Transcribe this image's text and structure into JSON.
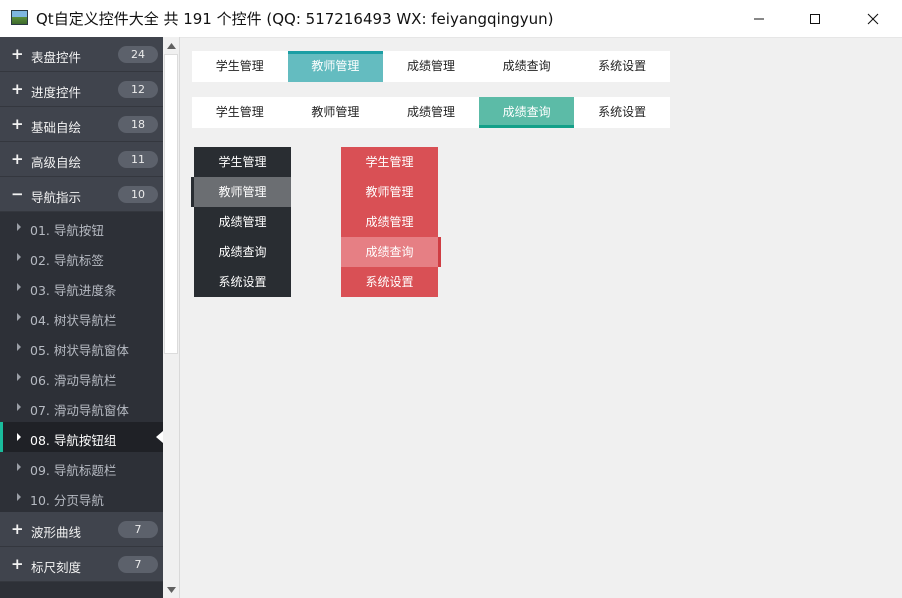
{
  "window": {
    "title": "Qt自定义控件大全 共 191 个控件 (QQ: 517216493 WX: feiyangqingyun)"
  },
  "sidebar": {
    "groups_top": [
      {
        "label": "表盘控件",
        "count": "24",
        "icon": "plus-icon"
      },
      {
        "label": "进度控件",
        "count": "12",
        "icon": "plus-icon"
      },
      {
        "label": "基础自绘",
        "count": "18",
        "icon": "plus-icon"
      },
      {
        "label": "高级自绘",
        "count": "11",
        "icon": "plus-icon"
      },
      {
        "label": "导航指示",
        "count": "10",
        "icon": "minus-icon"
      }
    ],
    "items": [
      {
        "label": "01. 导航按钮"
      },
      {
        "label": "02. 导航标签"
      },
      {
        "label": "03. 导航进度条"
      },
      {
        "label": "04. 树状导航栏"
      },
      {
        "label": "05. 树状导航窗体"
      },
      {
        "label": "06. 滑动导航栏"
      },
      {
        "label": "07. 滑动导航窗体"
      },
      {
        "label": "08. 导航按钮组",
        "selected": true
      },
      {
        "label": "09. 导航标题栏"
      },
      {
        "label": "10. 分页导航"
      }
    ],
    "groups_bottom": [
      {
        "label": "波形曲线",
        "count": "7",
        "icon": "plus-icon"
      },
      {
        "label": "标尺刻度",
        "count": "7",
        "icon": "plus-icon"
      }
    ]
  },
  "nav_bar_top": {
    "accent": "#64bcc0",
    "buttons": [
      "学生管理",
      "教师管理",
      "成绩管理",
      "成绩查询",
      "系统设置"
    ],
    "selected": "教师管理"
  },
  "nav_bar_second": {
    "accent": "#5cbba7",
    "buttons": [
      "学生管理",
      "教师管理",
      "成绩管理",
      "成绩查询",
      "系统设置"
    ],
    "selected": "成绩查询"
  },
  "nav_vertical_dark": {
    "accent": "#292d32",
    "buttons": [
      "学生管理",
      "教师管理",
      "成绩管理",
      "成绩查询",
      "系统设置"
    ],
    "selected": "教师管理"
  },
  "nav_vertical_red": {
    "accent": "#d95055",
    "buttons": [
      "学生管理",
      "教师管理",
      "成绩管理",
      "成绩查询",
      "系统设置"
    ],
    "selected": "成绩查询"
  }
}
